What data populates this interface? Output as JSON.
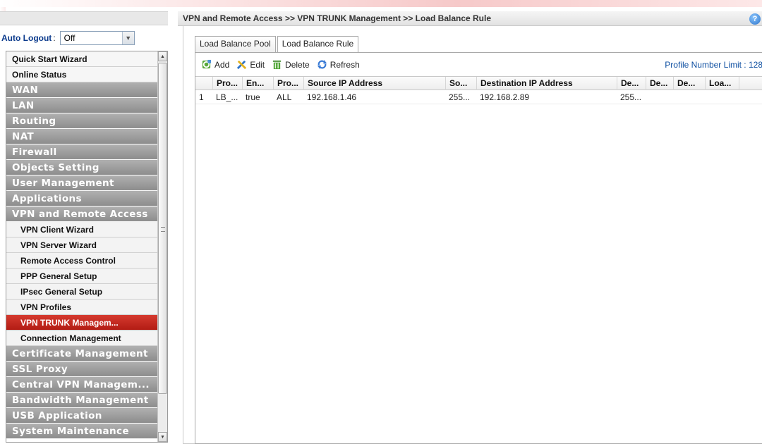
{
  "auto_logout": {
    "label": "Auto Logout",
    "colon": ":",
    "value": "Off"
  },
  "menu": [
    {
      "label": "Quick Start Wizard",
      "style": "white"
    },
    {
      "label": "Online Status",
      "style": "white"
    },
    {
      "label": "WAN",
      "style": "gray"
    },
    {
      "label": "LAN",
      "style": "gray"
    },
    {
      "label": "Routing",
      "style": "gray"
    },
    {
      "label": "NAT",
      "style": "gray"
    },
    {
      "label": "Firewall",
      "style": "gray"
    },
    {
      "label": "Objects Setting",
      "style": "gray"
    },
    {
      "label": "User Management",
      "style": "gray"
    },
    {
      "label": "Applications",
      "style": "gray"
    },
    {
      "label": "VPN and Remote Access",
      "style": "gray"
    },
    {
      "label": "VPN Client Wizard",
      "style": "sub"
    },
    {
      "label": "VPN Server Wizard",
      "style": "sub"
    },
    {
      "label": "Remote Access Control",
      "style": "sub"
    },
    {
      "label": "PPP General Setup",
      "style": "sub"
    },
    {
      "label": "IPsec General Setup",
      "style": "sub"
    },
    {
      "label": "VPN Profiles",
      "style": "sub"
    },
    {
      "label": "VPN TRUNK Managem...",
      "style": "sub",
      "active": true
    },
    {
      "label": "Connection Management",
      "style": "sub"
    },
    {
      "label": "Certificate Management",
      "style": "gray"
    },
    {
      "label": "SSL Proxy",
      "style": "gray"
    },
    {
      "label": "Central VPN Managem...",
      "style": "gray"
    },
    {
      "label": "Bandwidth Management",
      "style": "gray"
    },
    {
      "label": "USB Application",
      "style": "gray"
    },
    {
      "label": "System Maintenance",
      "style": "gray"
    }
  ],
  "breadcrumb": "VPN and Remote Access >> VPN TRUNK Management >> Load Balance Rule",
  "tabs": [
    "Load Balance Pool",
    "Load Balance Rule"
  ],
  "toolbar": {
    "add": "Add",
    "edit": "Edit",
    "delete": "Delete",
    "refresh": "Refresh",
    "profile_limit": "Profile Number Limit : 128"
  },
  "columns": [
    "Pro...",
    "En...",
    "Pro...",
    "Source IP Address",
    "So...",
    "Destination IP Address",
    "De...",
    "De...",
    "De...",
    "Loa..."
  ],
  "rows": [
    [
      "1",
      "LB_...",
      "true",
      "ALL",
      "192.168.1.46",
      "255...",
      "192.168.2.89",
      "255...",
      "",
      "",
      ""
    ]
  ],
  "colors": {
    "active_menu": "#c4261d",
    "link_blue": "#0e4fa1"
  }
}
